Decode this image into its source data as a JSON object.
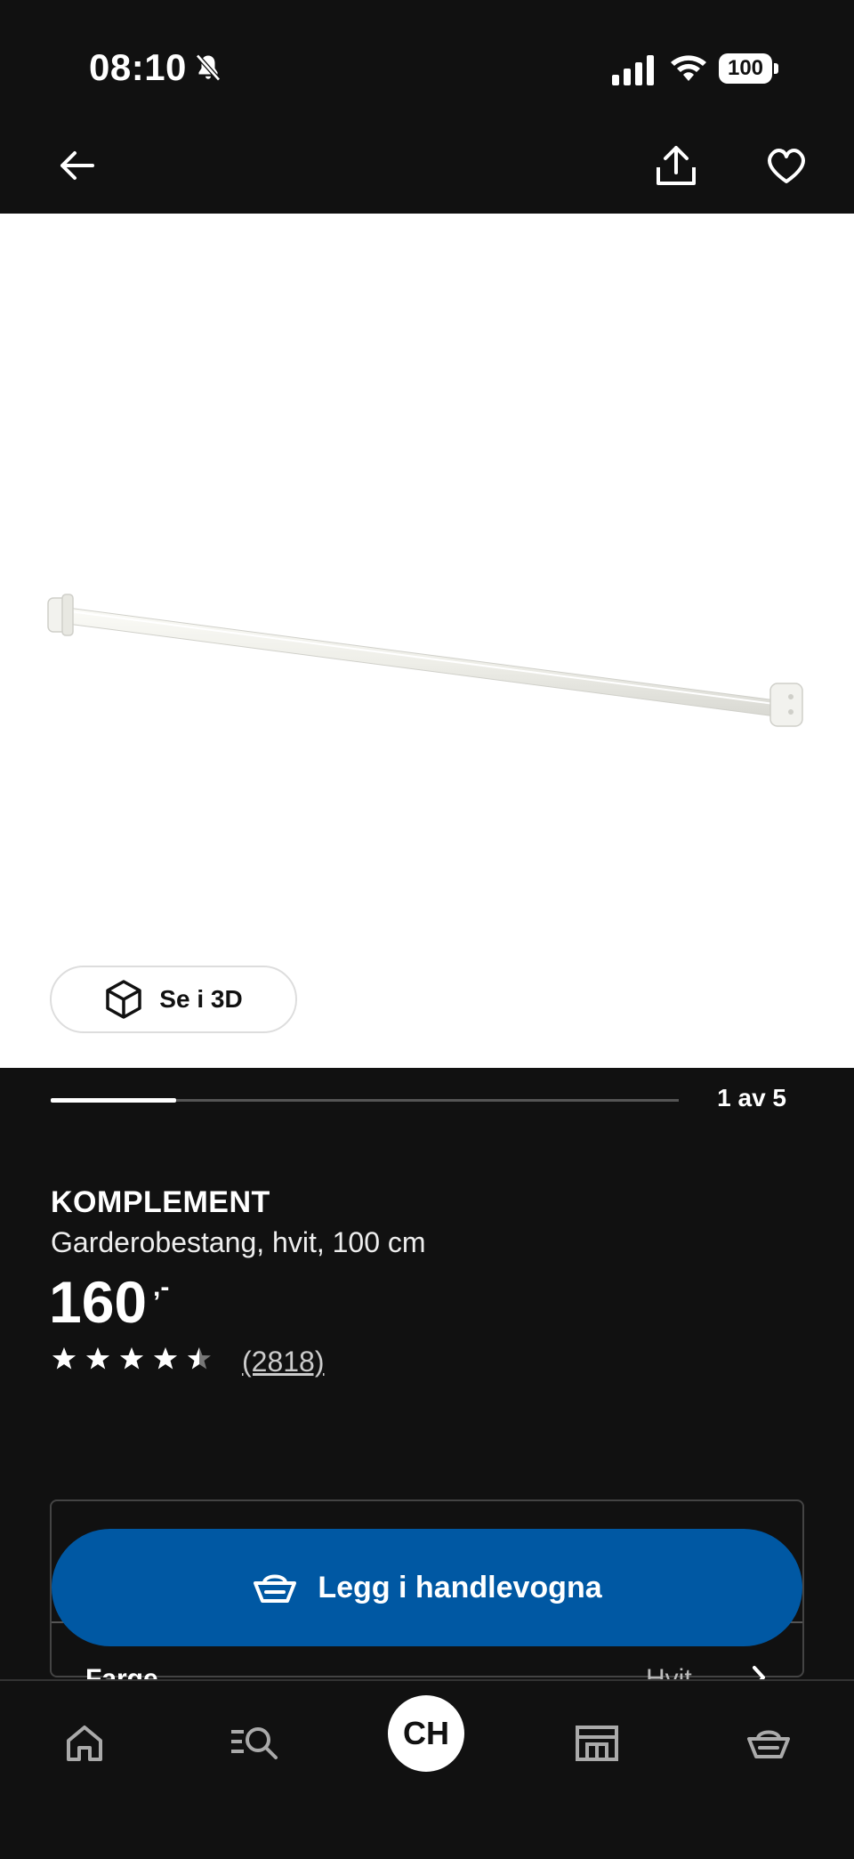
{
  "status_bar": {
    "time": "08:10",
    "battery": "100"
  },
  "product": {
    "gallery": {
      "view_3d_label": "Se i 3D",
      "page_indicator": "1 av 5",
      "current_page": 1,
      "total_pages": 5
    },
    "brand": "KOMPLEMENT",
    "description": "Garderobestang, hvit, 100 cm",
    "price": "160",
    "price_suffix": ",-",
    "rating": {
      "value": 4.5,
      "max": 5,
      "reviews": "(2818)"
    }
  },
  "cta": {
    "add_to_cart_label": "Legg i handlevogna"
  },
  "options": {
    "color_label": "Farge",
    "color_value": "Hvit"
  },
  "bottom_nav": {
    "profile_initials": "CH"
  },
  "colors": {
    "accent": "#0058A3",
    "background": "#111111"
  }
}
